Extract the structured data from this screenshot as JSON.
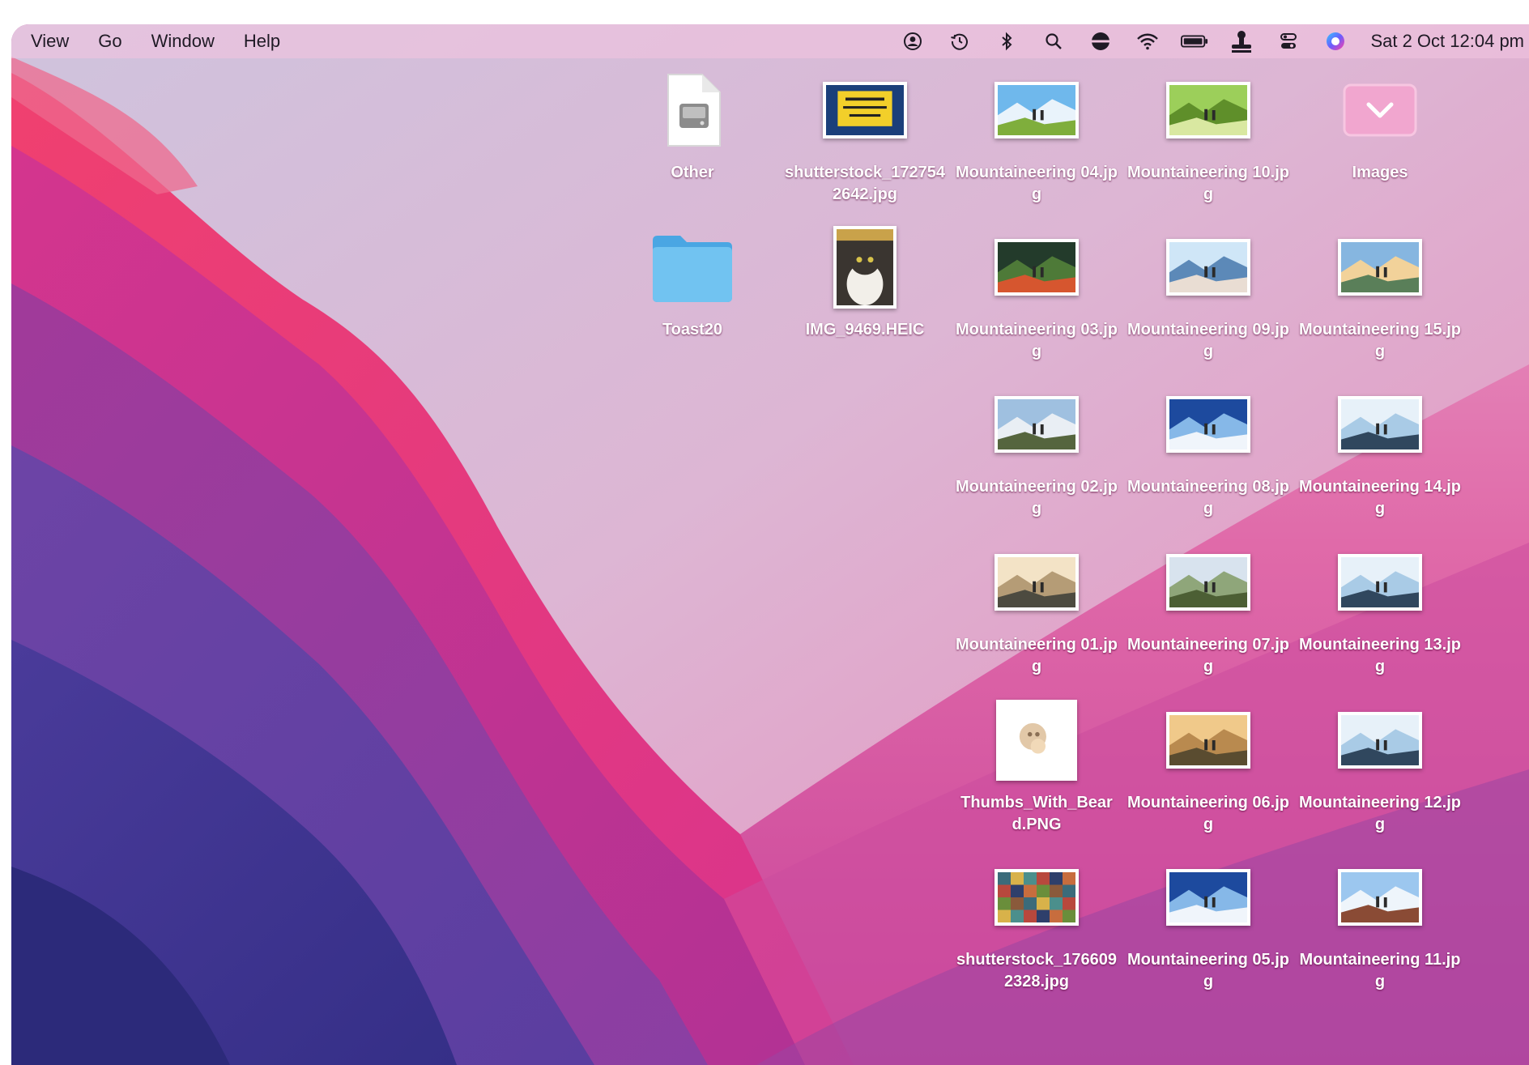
{
  "menubar": {
    "menus": [
      "View",
      "Go",
      "Window",
      "Help"
    ],
    "status_icons": [
      "user-account-icon",
      "time-machine-icon",
      "bluetooth-icon",
      "spotlight-search-icon",
      "half-circle-app-icon",
      "wifi-icon",
      "battery-icon",
      "stamp-app-icon",
      "control-center-icon",
      "siri-icon"
    ],
    "clock": "Sat 2 Oct  12:04 pm"
  },
  "wallpaper": {
    "colors": [
      "#d9c3dc",
      "#e28ab8",
      "#dd3f91",
      "#b33d98",
      "#7b44a6",
      "#3c3b96"
    ]
  },
  "desktop": {
    "items": [
      {
        "label": "Other",
        "kind": "drive",
        "col": 0,
        "row": 0
      },
      {
        "label": "shutterstock_1727542642.jpg",
        "kind": "photo",
        "theme": "sign",
        "col": 1,
        "row": 0
      },
      {
        "label": "Mountaineering 04.jpg",
        "kind": "photo",
        "theme": "meadow",
        "col": 2,
        "row": 0
      },
      {
        "label": "Mountaineering 10.jpg",
        "kind": "photo",
        "theme": "hills",
        "col": 3,
        "row": 0
      },
      {
        "label": "Images",
        "kind": "folder-collapse",
        "col": 4,
        "row": 0
      },
      {
        "label": "Toast20",
        "kind": "folder",
        "col": 0,
        "row": 1
      },
      {
        "label": "IMG_9469.HEIC",
        "kind": "photo-portrait",
        "theme": "cat",
        "col": 1,
        "row": 1
      },
      {
        "label": "Mountaineering 03.jpg",
        "kind": "photo",
        "theme": "forest",
        "col": 2,
        "row": 1
      },
      {
        "label": "Mountaineering 09.jpg",
        "kind": "photo",
        "theme": "sky",
        "col": 3,
        "row": 1
      },
      {
        "label": "Mountaineering 15.jpg",
        "kind": "photo",
        "theme": "sunset",
        "col": 4,
        "row": 1
      },
      {
        "label": "Mountaineering 02.jpg",
        "kind": "photo",
        "theme": "ridge",
        "col": 2,
        "row": 2
      },
      {
        "label": "Mountaineering 08.jpg",
        "kind": "photo",
        "theme": "blue",
        "col": 3,
        "row": 2
      },
      {
        "label": "Mountaineering 14.jpg",
        "kind": "photo",
        "theme": "snow",
        "col": 4,
        "row": 2
      },
      {
        "label": "Mountaineering 01.jpg",
        "kind": "photo",
        "theme": "dusk",
        "col": 2,
        "row": 3
      },
      {
        "label": "Mountaineering 07.jpg",
        "kind": "photo",
        "theme": "valley",
        "col": 3,
        "row": 3
      },
      {
        "label": "Mountaineering 13.jpg",
        "kind": "photo",
        "theme": "snow",
        "col": 4,
        "row": 3
      },
      {
        "label": "Thumbs_With_Beard.PNG",
        "kind": "photo-square",
        "theme": "emoji",
        "col": 2,
        "row": 4
      },
      {
        "label": "Mountaineering 06.jpg",
        "kind": "photo",
        "theme": "golden",
        "col": 3,
        "row": 4
      },
      {
        "label": "Mountaineering 12.jpg",
        "kind": "photo",
        "theme": "snow",
        "col": 4,
        "row": 4
      },
      {
        "label": "shutterstock_1766092328.jpg",
        "kind": "photo",
        "theme": "collage",
        "col": 2,
        "row": 5
      },
      {
        "label": "Mountaineering 05.jpg",
        "kind": "photo",
        "theme": "blue",
        "col": 3,
        "row": 5
      },
      {
        "label": "Mountaineering 11.jpg",
        "kind": "photo",
        "theme": "peak",
        "col": 4,
        "row": 5
      }
    ]
  }
}
